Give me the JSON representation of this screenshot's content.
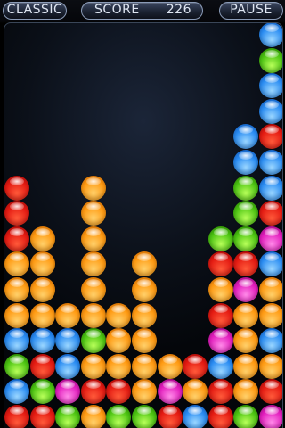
{
  "header": {
    "mode_label": "CLASSIC",
    "score_label": "SCORE",
    "score_value": "226",
    "pause_label": "PAUSE"
  },
  "board": {
    "columns": 11,
    "column_stacks_bottom_to_top": [
      [
        "red",
        "blue",
        "green",
        "blue",
        "orange",
        "orange",
        "orange",
        "red",
        "red",
        "red"
      ],
      [
        "red",
        "green",
        "red",
        "blue",
        "orange",
        "orange",
        "orange",
        "orange"
      ],
      [
        "green",
        "magenta",
        "blue",
        "blue",
        "orange"
      ],
      [
        "orange",
        "red",
        "orange",
        "green",
        "orange",
        "orange",
        "orange",
        "orange",
        "orange",
        "orange"
      ],
      [
        "green",
        "red",
        "orange",
        "orange",
        "orange"
      ],
      [
        "green",
        "orange",
        "orange",
        "orange",
        "orange",
        "orange",
        "orange"
      ],
      [
        "red",
        "magenta",
        "orange"
      ],
      [
        "blue",
        "orange",
        "red"
      ],
      [
        "red",
        "red",
        "blue",
        "magenta",
        "red",
        "orange",
        "red",
        "green"
      ],
      [
        "green",
        "orange",
        "orange",
        "orange",
        "orange",
        "magenta",
        "red",
        "green",
        "green",
        "green",
        "blue",
        "blue"
      ],
      [
        "magenta",
        "red",
        "orange",
        "blue",
        "orange",
        "orange",
        "blue",
        "magenta",
        "red",
        "blue",
        "blue",
        "red",
        "blue",
        "blue",
        "green",
        "blue"
      ]
    ]
  },
  "colors": {
    "red": "#e41a12",
    "orange": "#ff9a12",
    "blue": "#2a8cf2",
    "green": "#4cc412",
    "magenta": "#e31dbe"
  }
}
